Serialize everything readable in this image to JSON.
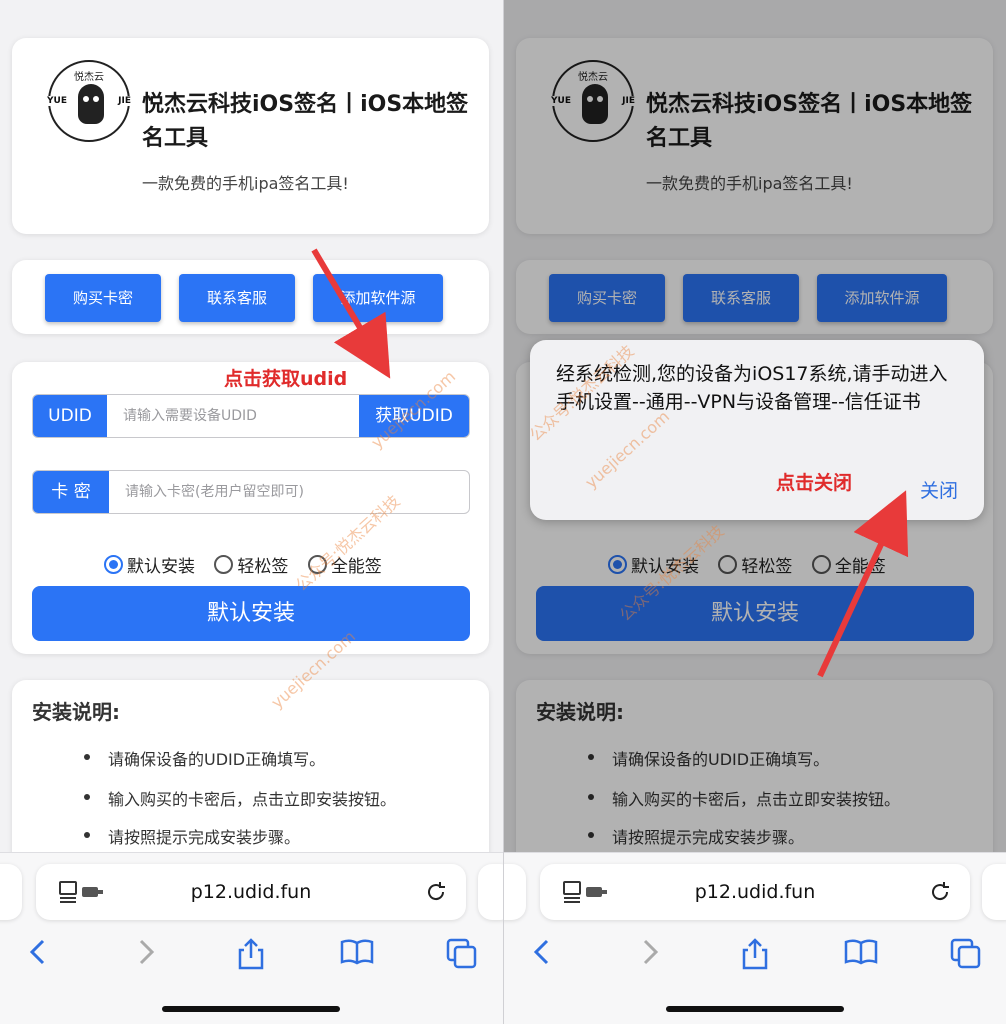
{
  "site": {
    "logo_top": "悦杰云",
    "logo_left": "YUE",
    "logo_right": "JIE",
    "title": "悦杰云科技iOS签名丨iOS本地签名工具",
    "subtitle": "一款免费的手机ipa签名工具!"
  },
  "buttons": [
    "购买卡密",
    "联系客服",
    "添加软件源"
  ],
  "form": {
    "udid_label": "UDID",
    "udid_placeholder": "请输入需要设备UDID",
    "get_udid": "获取UDID",
    "key_label": "卡 密",
    "key_placeholder": "请输入卡密(老用户留空即可)",
    "radio_options": [
      "默认安装",
      "轻松签",
      "全能签"
    ],
    "selected": "默认安装",
    "install_button": "默认安装"
  },
  "notes": {
    "title": "安装说明:",
    "items": [
      "请确保设备的UDID正确填写。",
      "输入购买的卡密后，点击立即安装按钮。",
      "请按照提示完成安装步骤。"
    ]
  },
  "annotations": {
    "left": "点击获取udid",
    "right": "点击关闭"
  },
  "alert": {
    "message": "经系统检测,您的设备为iOS17系统,请手动进入手机设置--通用--VPN与设备管理--信任证书",
    "close": "关闭"
  },
  "browser": {
    "url": "p12.udid.fun",
    "icons": [
      "page-menu-icon",
      "reload-icon",
      "back-icon",
      "forward-icon",
      "share-icon",
      "bookmarks-icon",
      "tabs-icon"
    ]
  },
  "watermark": {
    "a": "yuejiecn.com",
    "b": "公众号:悦杰云科技"
  },
  "colors": {
    "accent": "#2b74f5",
    "annotation": "#e02b2b",
    "link": "#2f6fe0"
  }
}
